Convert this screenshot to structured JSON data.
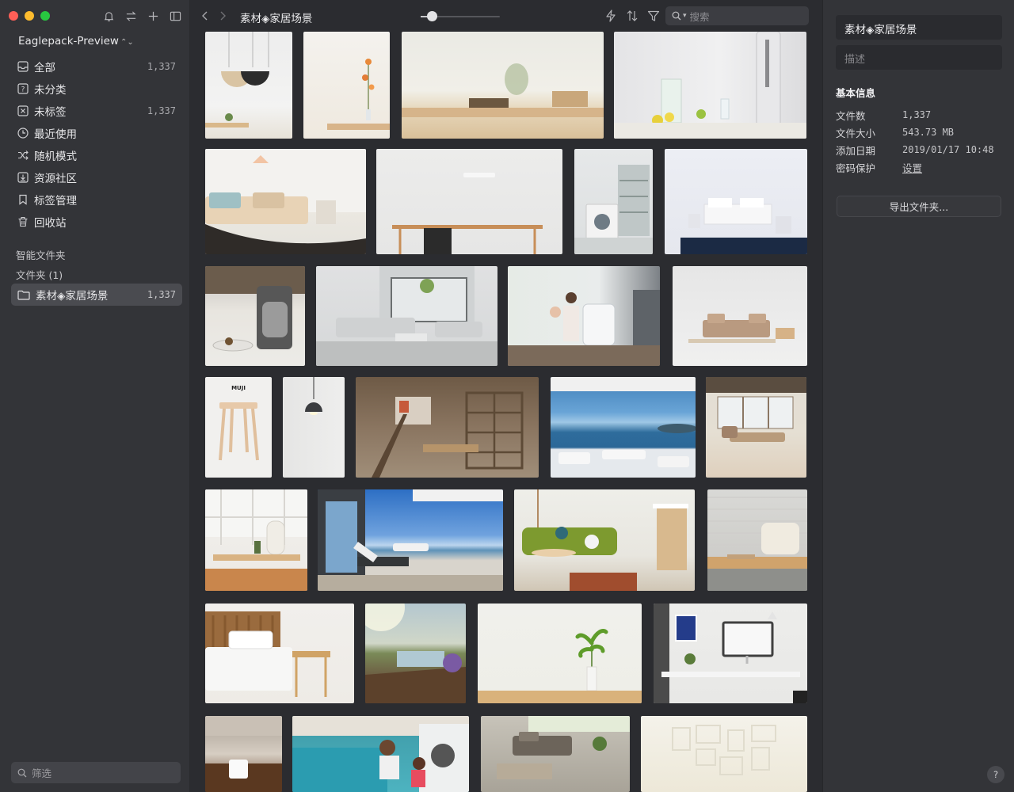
{
  "sidebar": {
    "library_name": "Eaglepack-Preview",
    "items": [
      {
        "icon": "inbox-icon",
        "label": "全部",
        "count": "1,337"
      },
      {
        "icon": "question-box-icon",
        "label": "未分类",
        "count": ""
      },
      {
        "icon": "untagged-icon",
        "label": "未标签",
        "count": "1,337"
      },
      {
        "icon": "clock-icon",
        "label": "最近使用",
        "count": ""
      },
      {
        "icon": "shuffle-icon",
        "label": "随机模式",
        "count": ""
      },
      {
        "icon": "download-box-icon",
        "label": "资源社区",
        "count": ""
      },
      {
        "icon": "bookmark-icon",
        "label": "标签管理",
        "count": ""
      },
      {
        "icon": "trash-icon",
        "label": "回收站",
        "count": ""
      }
    ],
    "smart_folders_label": "智能文件夹",
    "folders_label": "文件夹 (1)",
    "selected_folder": {
      "label": "素材◈家居场景",
      "count": "1,337"
    },
    "filter_placeholder": "筛选"
  },
  "toolbar": {
    "title": "素材◈家居场景",
    "search_placeholder": "搜索"
  },
  "inspector": {
    "title": "素材◈家居场景",
    "description_placeholder": "描述",
    "section_title": "基本信息",
    "rows": [
      {
        "key": "文件数",
        "value": "1,337"
      },
      {
        "key": "文件大小",
        "value": "543.73 MB"
      },
      {
        "key": "添加日期",
        "value": "2019/01/17 10:48"
      },
      {
        "key": "密码保护",
        "value": "设置"
      }
    ],
    "export_label": "导出文件夹...",
    "help_label": "?"
  },
  "colors": {
    "window_bg": "#2b2c30",
    "sidebar_bg": "#333438",
    "selected_bg": "#4a4b50"
  }
}
